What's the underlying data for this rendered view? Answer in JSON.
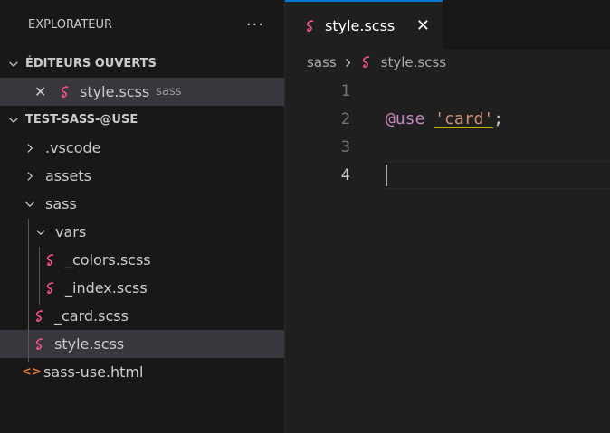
{
  "sidebar": {
    "title": "EXPLORATEUR",
    "more_icon": "more-icon",
    "open_editors": {
      "label": "ÉDITEURS OUVERTS",
      "items": [
        {
          "name": "style.scss",
          "desc": "sass"
        }
      ]
    },
    "project": {
      "label": "TEST-SASS-@USE",
      "tree": [
        {
          "name": ".vscode",
          "type": "folder",
          "expanded": false
        },
        {
          "name": "assets",
          "type": "folder",
          "expanded": false
        },
        {
          "name": "sass",
          "type": "folder",
          "expanded": true
        },
        {
          "name": "vars",
          "type": "folder",
          "expanded": true
        },
        {
          "name": "_colors.scss",
          "type": "sass"
        },
        {
          "name": "_index.scss",
          "type": "sass"
        },
        {
          "name": "_card.scss",
          "type": "sass"
        },
        {
          "name": "style.scss",
          "type": "sass",
          "selected": true
        },
        {
          "name": "sass-use.html",
          "type": "html",
          "icon_glyph": "<>"
        }
      ]
    }
  },
  "editor": {
    "tab": {
      "label": "style.scss",
      "close": "✕"
    },
    "breadcrumb": {
      "folder": "sass",
      "file": "style.scss"
    },
    "lines": [
      {
        "num": "1"
      },
      {
        "num": "2",
        "kw": "@use",
        "str": "'card'",
        "punc": ";"
      },
      {
        "num": "3"
      },
      {
        "num": "4",
        "current": true
      }
    ]
  },
  "colors": {
    "accent": "#0078d4",
    "sass": "#f55385",
    "html": "#e37933",
    "keyword": "#c586c0",
    "string": "#ce9178"
  }
}
